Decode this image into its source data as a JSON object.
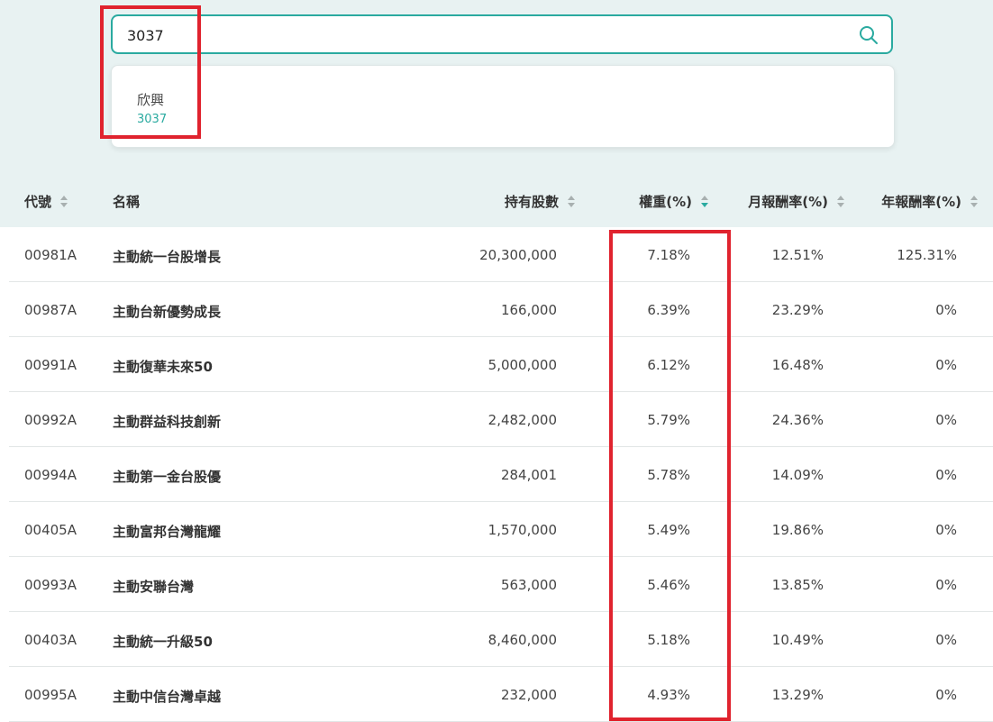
{
  "search": {
    "value": "3037"
  },
  "suggestions": [
    {
      "name": "欣興",
      "code": "3037"
    }
  ],
  "headers": {
    "code": "代號",
    "name": "名稱",
    "shares": "持有股數",
    "weight": "權重(%)",
    "monthly": "月報酬率(%)",
    "yearly": "年報酬率(%)"
  },
  "sort": {
    "active_column": "weight",
    "direction": "descending"
  },
  "rows": [
    {
      "code": "00981A",
      "name": "主動統一台股增長",
      "shares": "20,300,000",
      "weight": "7.18%",
      "monthly": "12.51%",
      "yearly": "125.31%"
    },
    {
      "code": "00987A",
      "name": "主動台新優勢成長",
      "shares": "166,000",
      "weight": "6.39%",
      "monthly": "23.29%",
      "yearly": "0%"
    },
    {
      "code": "00991A",
      "name": "主動復華未來50",
      "shares": "5,000,000",
      "weight": "6.12%",
      "monthly": "16.48%",
      "yearly": "0%"
    },
    {
      "code": "00992A",
      "name": "主動群益科技創新",
      "shares": "2,482,000",
      "weight": "5.79%",
      "monthly": "24.36%",
      "yearly": "0%"
    },
    {
      "code": "00994A",
      "name": "主動第一金台股優",
      "shares": "284,001",
      "weight": "5.78%",
      "monthly": "14.09%",
      "yearly": "0%"
    },
    {
      "code": "00405A",
      "name": "主動富邦台灣龍耀",
      "shares": "1,570,000",
      "weight": "5.49%",
      "monthly": "19.86%",
      "yearly": "0%"
    },
    {
      "code": "00993A",
      "name": "主動安聯台灣",
      "shares": "563,000",
      "weight": "5.46%",
      "monthly": "13.85%",
      "yearly": "0%"
    },
    {
      "code": "00403A",
      "name": "主動統一升級50",
      "shares": "8,460,000",
      "weight": "5.18%",
      "monthly": "10.49%",
      "yearly": "0%"
    },
    {
      "code": "00995A",
      "name": "主動中信台灣卓越",
      "shares": "232,000",
      "weight": "4.93%",
      "monthly": "13.29%",
      "yearly": "0%"
    }
  ],
  "colors": {
    "accent": "#2aaaa0",
    "highlight": "#e0232e",
    "header_bg": "#e8f2f2"
  }
}
